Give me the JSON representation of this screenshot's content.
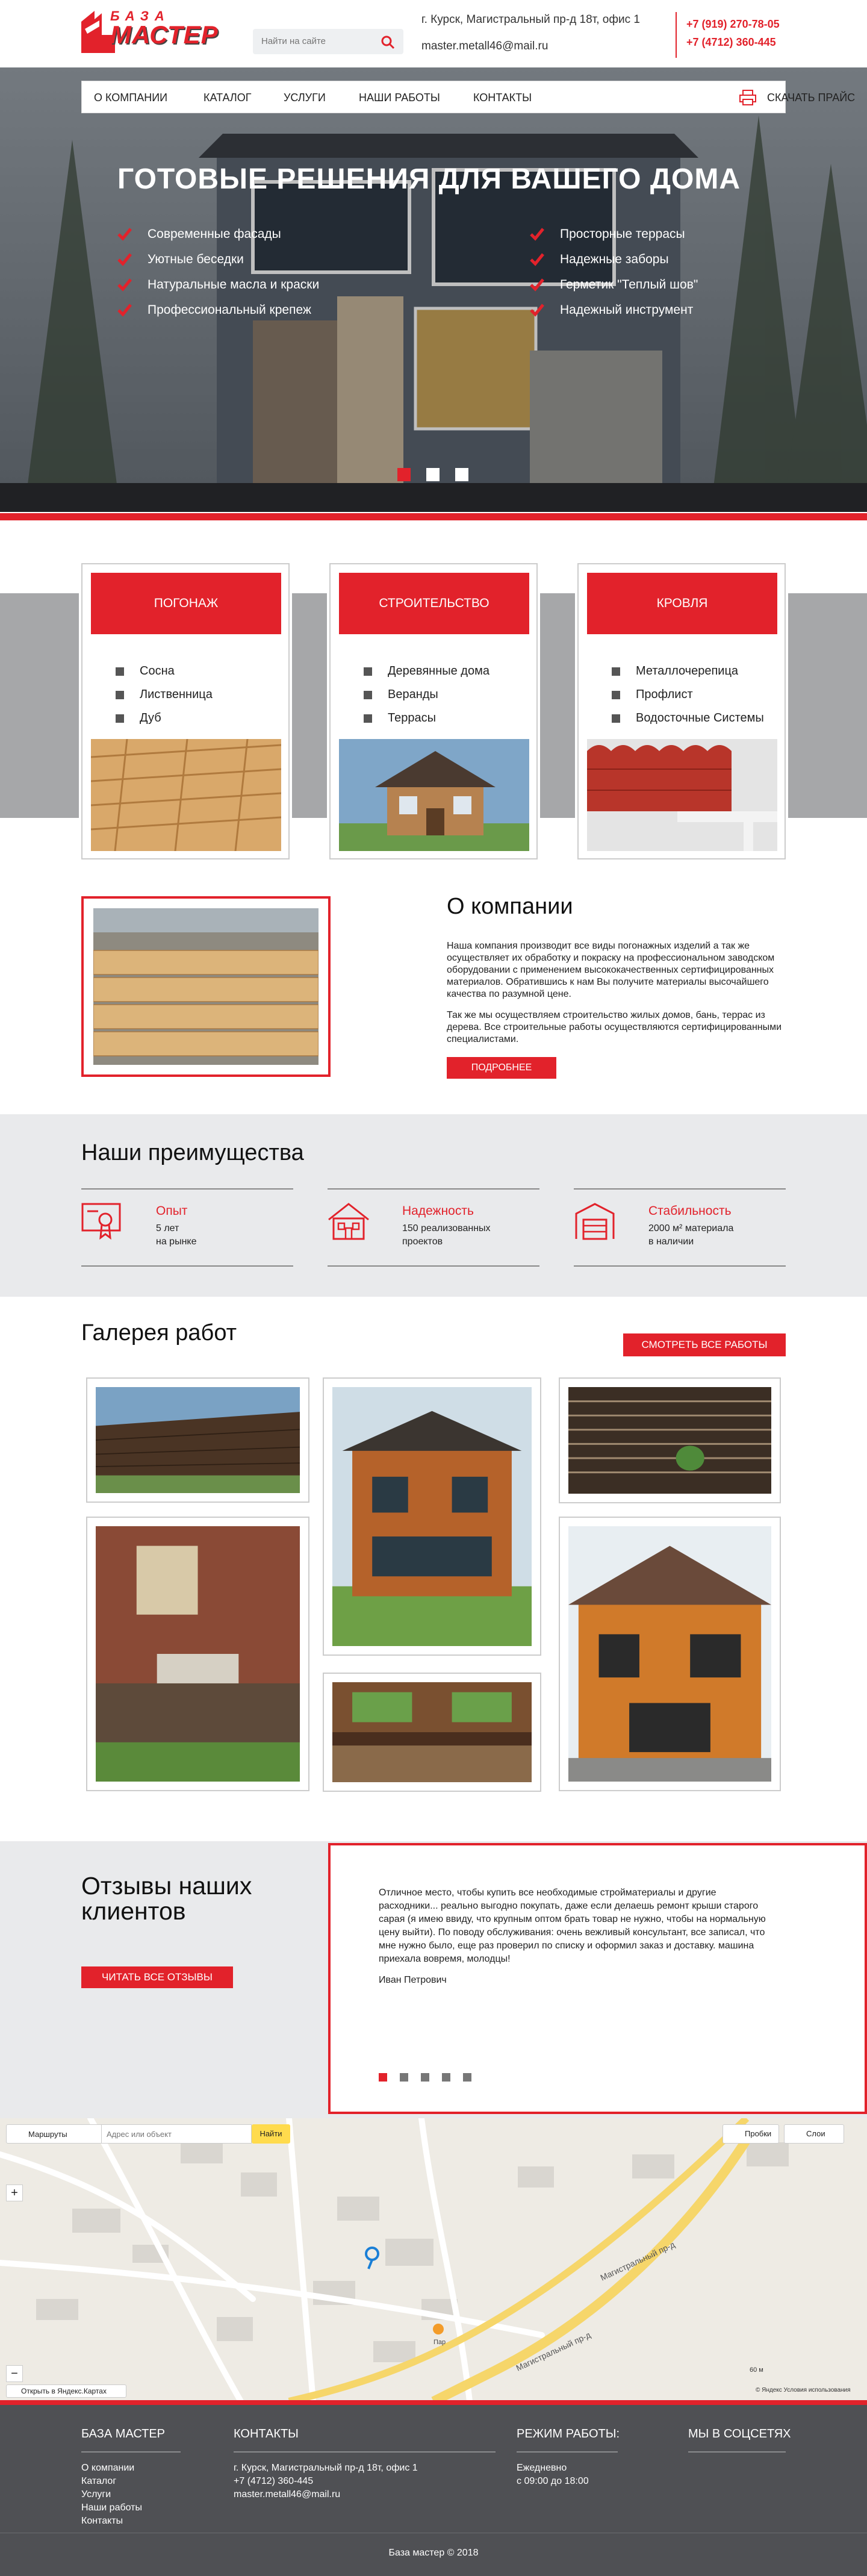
{
  "brand": {
    "top": "БАЗА",
    "bottom": "МАСТЕР",
    "red": "#e2222b"
  },
  "header": {
    "search_placeholder": "Найти на сайте",
    "address": "г. Курск, Магистральный пр-д 18т, офис 1",
    "email": "master.metall46@mail.ru",
    "phone1": "+7 (919) 270-78-05",
    "phone2": "+7 (4712) 360-445"
  },
  "nav": {
    "items": [
      "О компании",
      "Каталог",
      "Услуги",
      "Наши работы",
      "Контакты"
    ],
    "price_label": "Скачать прайс"
  },
  "hero": {
    "title": "Готовые решения для вашего дома",
    "features_left": [
      "Современные фасады",
      "Уютные беседки",
      "Натуральные масла и краски",
      "Профессиональный крепеж"
    ],
    "features_right": [
      "Просторные террасы",
      "Надежные заборы",
      "Герметик \"Теплый шов\"",
      "Надежный инструмент"
    ]
  },
  "categories": [
    {
      "title": "Погонаж",
      "items": [
        "Сосна",
        "Лиственница",
        "Дуб"
      ]
    },
    {
      "title": "Строительство",
      "items": [
        "Деревянные дома",
        "Веранды",
        "Террасы"
      ]
    },
    {
      "title": "Кровля",
      "items": [
        "Металлочерепица",
        "Профлист",
        "Водосточные Системы"
      ]
    }
  ],
  "about": {
    "title": "О компании",
    "p1": "Наша компания производит все виды погонажных изделий а так же осуществляет их обработку и покраску на профессиональном заводском оборудовании с применением высококачественных сертифицированных материалов. Обратившись к нам Вы получите материалы высочайшего качества по разумной цене.",
    "p2": "Так же мы осуществляем строительство жилых домов, бань, террас из дерева. Все строительные работы осуществляются сертифицированными специалистами.",
    "button": "Подробнее"
  },
  "advantages": {
    "title": "Наши преимущества",
    "items": [
      {
        "icon": "certificate-icon",
        "title": "Опыт",
        "line1": "5 лет",
        "line2": "на рынке"
      },
      {
        "icon": "house-icon",
        "title": "Надежность",
        "line1": "150 реализованных",
        "line2": "проектов"
      },
      {
        "icon": "warehouse-icon",
        "title": "Стабильность",
        "line1": "2000 м² материала",
        "line2": "в наличии"
      }
    ]
  },
  "gallery": {
    "title": "Галерея работ",
    "button": "Смотреть все работы"
  },
  "reviews": {
    "title": "Отзывы наших клиентов",
    "button": "Читать все отзывы",
    "text": "Отличное место, чтобы купить все необходимые стройматериалы и другие расходники... реально выгодно покупать, даже если делаешь ремонт крыши старого сарая (я имею ввиду, что крупным оптом брать товар не нужно, чтобы на нормальную цену выйти). По поводу обслуживания: очень вежливый консультант, все записал, что мне нужно было, еще раз проверил по списку и оформил заказ и доставку. машина приехала вовремя, молодцы!",
    "author": "Иван Петрович"
  },
  "map": {
    "routes": "Маршруты",
    "placeholder": "Адрес или объект",
    "find": "Найти",
    "traffic": "Пробки",
    "layers": "Слои",
    "open": "Открыть в Яндекс.Картах",
    "street1": "Магистральный пр-д",
    "street2": "Магистральный пр-д",
    "copyright": "© Яндекс Условия использования",
    "scale": "60 м",
    "pin_label": "Пар"
  },
  "footer": {
    "col1_title": "База мастер",
    "col1_links": [
      "О компании",
      "Каталог",
      "Услуги",
      "Наши работы",
      "Контакты"
    ],
    "col2_title": "Контакты",
    "col2_lines": [
      "г. Курск, Магистральный пр-д 18т, офис 1",
      "+7 (4712) 360-445",
      "master.metall46@mail.ru"
    ],
    "col3_title": "Режим работы:",
    "col3_lines": [
      "Ежедневно",
      "с 09:00 до 18:00"
    ],
    "col4_title": "Мы в соцсетях",
    "copyright": "База мастер © 2018"
  }
}
